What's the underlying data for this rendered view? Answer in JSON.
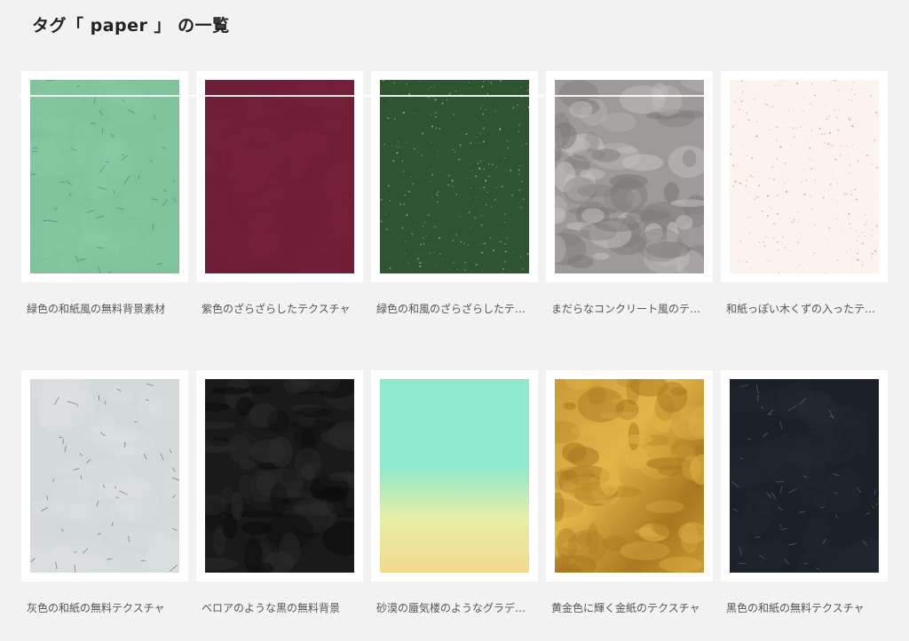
{
  "header": {
    "title": "タグ「 paper 」 の一覧"
  },
  "items": [
    {
      "caption": "緑色の和紙風の無料背景素材",
      "texture": "washi",
      "colors": [
        "#7fc29b",
        "#8dcaa6",
        "#4f7b63"
      ]
    },
    {
      "caption": "紫色のざらざらしたテクスチャ",
      "texture": "flat",
      "colors": [
        "#6e1e37",
        "#7a2541",
        "#5a1529"
      ]
    },
    {
      "caption": "緑色の和風のざらざらしたテクスチャ",
      "texture": "speckle",
      "colors": [
        "#2f5431",
        "#38603a",
        "#a7c48a"
      ]
    },
    {
      "caption": "まだらなコンクリート風のテクスチャ",
      "texture": "mottle",
      "colors": [
        "#9e9a9a",
        "#c7c3c3",
        "#7b7777"
      ]
    },
    {
      "caption": "和紙っぽい木くずの入ったテクスチャ",
      "texture": "speckle",
      "colors": [
        "#fbf3ee",
        "#fff8f4",
        "#d9927a"
      ]
    },
    {
      "caption": "灰色の和紙の無料テクスチャ",
      "texture": "washi",
      "colors": [
        "#d3d8d8",
        "#e0e4e4",
        "#59605f"
      ]
    },
    {
      "caption": "ベロアのような黒の無料背景",
      "texture": "mottle",
      "colors": [
        "#1a1a1a",
        "#2c2c2c",
        "#0c0c0c"
      ]
    },
    {
      "caption": "砂漠の蜃気楼のようなグラデーション",
      "texture": "gradient",
      "colors": [
        "#8ee9cc",
        "#e7eea8",
        "#f1d98c"
      ]
    },
    {
      "caption": "黄金色に輝く金紙のテクスチャ",
      "texture": "gold",
      "colors": [
        "#c99a37",
        "#e2b548",
        "#a9781f"
      ]
    },
    {
      "caption": "黒色の和紙の無料テクスチャ",
      "texture": "washi",
      "colors": [
        "#1c2028",
        "#252a33",
        "#6a6f78"
      ]
    }
  ]
}
